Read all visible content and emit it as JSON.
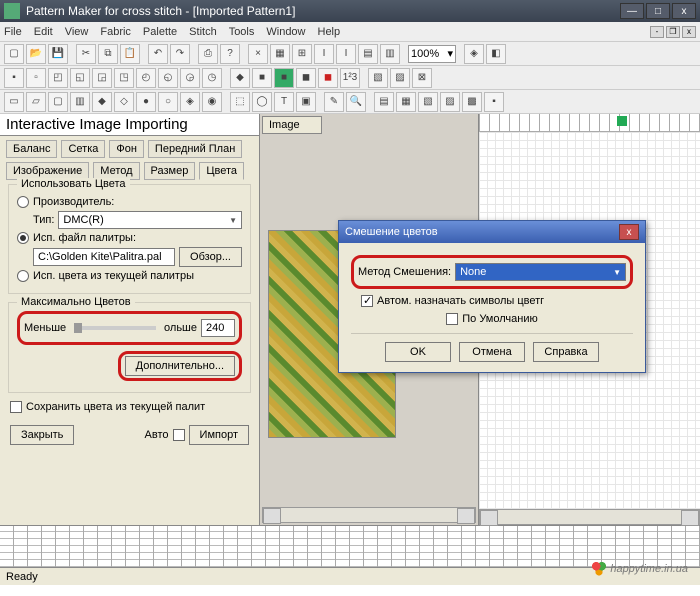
{
  "window": {
    "title": "Pattern Maker for cross stitch  -  [Imported Pattern1]"
  },
  "menu": [
    "File",
    "Edit",
    "View",
    "Fabric",
    "Palette",
    "Stitch",
    "Tools",
    "Window",
    "Help"
  ],
  "zoom": "100%",
  "leftPanel": {
    "title": "Interactive Image Importing",
    "tabs_row1": [
      "Баланс",
      "Сетка",
      "Фон",
      "Передний План"
    ],
    "tabs_row2": [
      "Изображение",
      "Метод",
      "Размер",
      "Цвета"
    ],
    "useColors": {
      "title": "Использовать Цвета",
      "optManufacturer": "Производитель:",
      "typeLabel": "Тип:",
      "typeValue": "DMC(R)",
      "optPaletteFile": "Исп. файл палитры:",
      "filePath": "C:\\Golden Kite\\Palitra.pal",
      "browse": "Обзор...",
      "optCurrent": "Исп. цвета из текущей палитры"
    },
    "maxColors": {
      "title": "Максимально Цветов",
      "less": "Меньше",
      "more": "ольше",
      "value": "240",
      "advanced": "Дополнительно..."
    },
    "saveColors": "Сохранить цвета из текущей палит",
    "close": "Закрыть",
    "auto": "Авто",
    "import": "Импорт"
  },
  "center": {
    "label": "Image"
  },
  "dialog": {
    "title": "Смешение цветов",
    "methodLabel": "Метод Смешения:",
    "methodValue": "None",
    "autoAssign": "Автом. назначать символы цветг",
    "default": "По Умолчанию",
    "ok": "OK",
    "cancel": "Отмена",
    "help": "Справка"
  },
  "status": "Ready",
  "watermark": "happytime.in.ua"
}
